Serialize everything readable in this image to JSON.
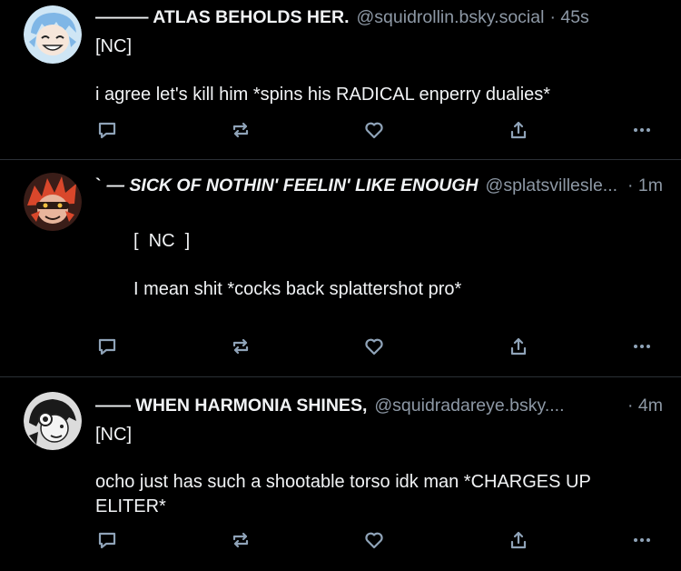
{
  "posts": [
    {
      "name": "——— ATLAS BEHOLDS HER.",
      "handle": "@squidrollin.bsky.social",
      "time": "· 45s",
      "lines": [
        "[NC]",
        "i agree let's kill him *spins his RADICAL enperry dualies*"
      ]
    },
    {
      "name_prefix": "`",
      "name": "— SICK OF NOTHIN' FEELIN' LIKE ENOUGH",
      "handle": "@splatsvillesle...",
      "time": "· 1m",
      "lines": [
        "[  NC  ]",
        "I mean shit *cocks back splattershot pro*"
      ]
    },
    {
      "name": "—— WHEN HARMONIA SHINES,",
      "handle": "@squidradareye.bsky....",
      "time": "· 4m",
      "lines": [
        "[NC]",
        "ocho just has such a shootable torso idk man *CHARGES UP",
        "ELITER*"
      ]
    }
  ],
  "icons": [
    "reply-icon",
    "repost-icon",
    "like-icon",
    "share-icon",
    "more-icon"
  ],
  "colors": {
    "background": "#000000",
    "text": "#f1f3f5",
    "muted": "#8d98a5",
    "icon": "#8fa3b8",
    "divider": "#2b3036"
  }
}
